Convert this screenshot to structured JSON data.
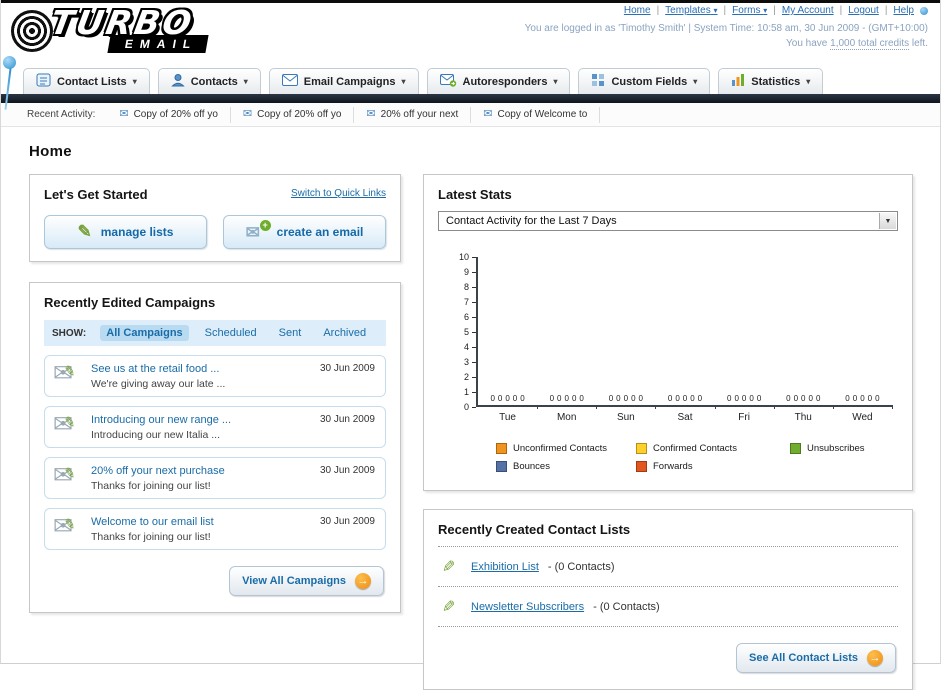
{
  "icons": {
    "caret": "▾",
    "select_arrow": "▼",
    "envelope": "✉",
    "pencil": "✎",
    "plus": "+",
    "arrow_right": "→"
  },
  "header": {
    "logo_line1": "TURBO",
    "logo_line2": "EMAIL",
    "links": [
      {
        "label": "Home"
      },
      {
        "label": "Templates"
      },
      {
        "label": "Forms"
      },
      {
        "label": "My Account"
      },
      {
        "label": "Logout"
      },
      {
        "label": "Help"
      }
    ],
    "session_line": "You are logged in as 'Timothy Smith' | System Time: 10:58 am, 30 Jun 2009 - (GMT+10:00)",
    "credits_prefix": "You have ",
    "credits_value": "1,000 total credits",
    "credits_suffix": " left."
  },
  "main_nav": [
    {
      "label": "Contact Lists"
    },
    {
      "label": "Contacts"
    },
    {
      "label": "Email Campaigns"
    },
    {
      "label": "Autoresponders"
    },
    {
      "label": "Custom Fields"
    },
    {
      "label": "Statistics"
    }
  ],
  "recent_activity": {
    "label": "Recent Activity:",
    "items": [
      "Copy of 20% off yo",
      "Copy of 20% off yo",
      "20% off your next",
      "Copy of Welcome to"
    ]
  },
  "page_title": "Home",
  "get_started": {
    "title": "Let's Get Started",
    "switch_link": "Switch to Quick Links",
    "buttons": [
      "manage lists",
      "create an email"
    ]
  },
  "campaigns": {
    "title": "Recently Edited Campaigns",
    "show_label": "SHOW:",
    "tabs": [
      "All Campaigns",
      "Scheduled",
      "Sent",
      "Archived"
    ],
    "selected_tab": 0,
    "items": [
      {
        "title": "See us at the retail food ...",
        "subtitle": "We're giving away our late ...",
        "date": "30 Jun 2009"
      },
      {
        "title": "Introducing our new range ...",
        "subtitle": "Introducing our new Italia ...",
        "date": "30 Jun 2009"
      },
      {
        "title": "20% off your next purchase",
        "subtitle": "Thanks for joining our list!",
        "date": "30 Jun 2009"
      },
      {
        "title": "Welcome to our email list",
        "subtitle": "Thanks for joining our list!",
        "date": "30 Jun 2009"
      }
    ],
    "view_all_label": "View All Campaigns"
  },
  "stats": {
    "title": "Latest Stats",
    "dropdown_value": "Contact Activity for the Last 7 Days",
    "chart_data": {
      "type": "bar",
      "title": "Contact Activity for the Last 7 Days",
      "categories": [
        "Tue",
        "Mon",
        "Sun",
        "Sat",
        "Fri",
        "Thu",
        "Wed"
      ],
      "series": [
        {
          "name": "Unconfirmed Contacts",
          "color": "#f0941e",
          "values": [
            0,
            0,
            0,
            0,
            0,
            0,
            0
          ]
        },
        {
          "name": "Confirmed Contacts",
          "color": "#ffcf2a",
          "values": [
            0,
            0,
            0,
            0,
            0,
            0,
            0
          ]
        },
        {
          "name": "Unsubscribes",
          "color": "#6fae2d",
          "values": [
            0,
            0,
            0,
            0,
            0,
            0,
            0
          ]
        },
        {
          "name": "Bounces",
          "color": "#5572a7",
          "values": [
            0,
            0,
            0,
            0,
            0,
            0,
            0
          ]
        },
        {
          "name": "Forwards",
          "color": "#e2571d",
          "values": [
            0,
            0,
            0,
            0,
            0,
            0,
            0
          ]
        }
      ],
      "xlabel": "",
      "ylabel": "",
      "ylim": [
        0,
        10
      ],
      "ytick_step": 1,
      "grid": false,
      "legend_position": "bottom"
    }
  },
  "contact_lists": {
    "title": "Recently Created Contact Lists",
    "items": [
      {
        "name": "Exhibition List",
        "detail": "- (0 Contacts)"
      },
      {
        "name": "Newsletter Subscribers",
        "detail": "- (0 Contacts)"
      }
    ],
    "see_all_label": "See All Contact Lists"
  }
}
